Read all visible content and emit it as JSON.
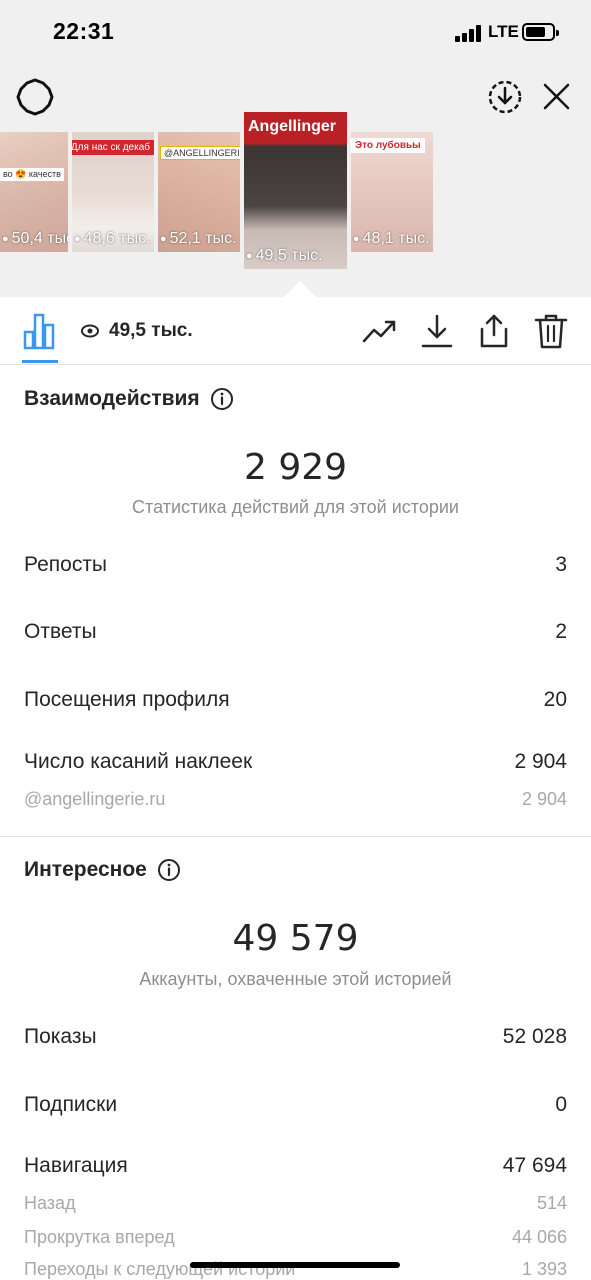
{
  "status_bar": {
    "time": "22:31",
    "network": "LTE"
  },
  "thumbnails": [
    {
      "views": "50,4 тыс.",
      "caption": "во 😍 качеств"
    },
    {
      "views": "48,6 тыс.",
      "caption": "Для нас ск декаб"
    },
    {
      "views": "52,1 тыс.",
      "caption": "@ANGELLINGERIE"
    },
    {
      "views": "49,5 тыс.",
      "caption": "Angellinger"
    },
    {
      "views": "48,1 тыс.",
      "caption": "Это лубовьы"
    }
  ],
  "toolbar": {
    "views": "49,5 тыс."
  },
  "interactions": {
    "title": "Взаимодействия",
    "total": "2 929",
    "subtitle": "Статистика действий для этой истории",
    "rows": [
      {
        "label": "Репосты",
        "value": "3"
      },
      {
        "label": "Ответы",
        "value": "2"
      },
      {
        "label": "Посещения профиля",
        "value": "20"
      },
      {
        "label": "Число касаний наклеек",
        "value": "2 904"
      }
    ],
    "sticker": {
      "label": "@angellingerie.ru",
      "value": "2 904"
    }
  },
  "discovery": {
    "title": "Интересное",
    "total": "49 579",
    "subtitle": "Аккаунты, охваченные этой историей",
    "rows": [
      {
        "label": "Показы",
        "value": "52 028"
      },
      {
        "label": "Подписки",
        "value": "0"
      },
      {
        "label": "Навигация",
        "value": "47 694"
      }
    ],
    "navigation": [
      {
        "label": "Назад",
        "value": "514"
      },
      {
        "label": "Прокрутка вперед",
        "value": "44 066"
      },
      {
        "label": "Переходы к следующей истории",
        "value": "1 393"
      }
    ]
  },
  "colors": {
    "accent": "#3897f0",
    "text": "#262626",
    "muted": "#8e8e8e",
    "top_bg": "#f0f0f0"
  }
}
